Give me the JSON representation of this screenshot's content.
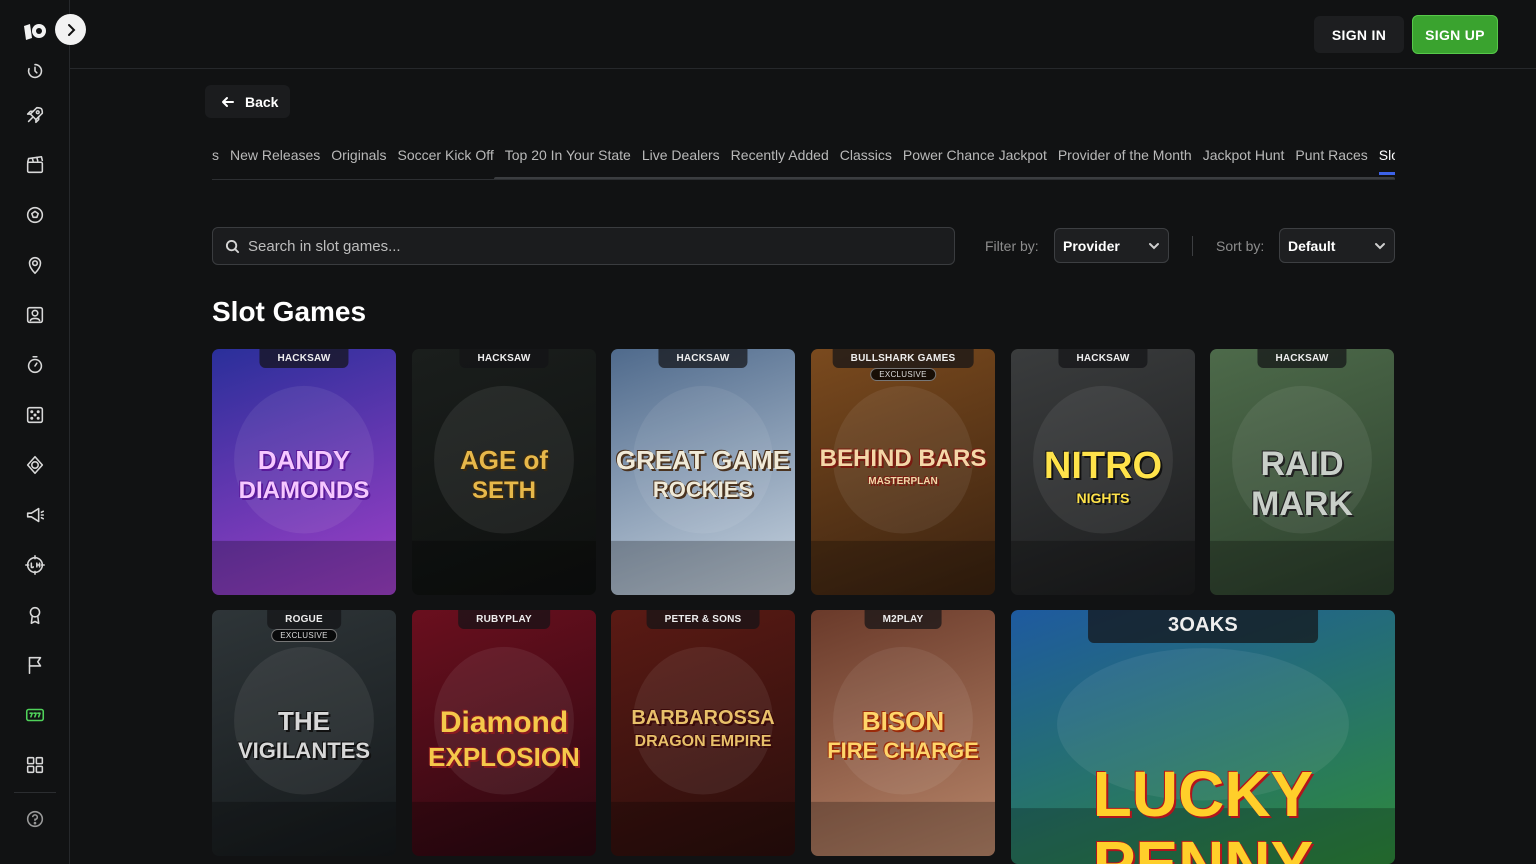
{
  "topbar": {
    "signin": "SIGN IN",
    "signup": "SIGN UP"
  },
  "back": {
    "label": "Back"
  },
  "tabs": [
    {
      "label": "s",
      "active": false
    },
    {
      "label": "New Releases",
      "active": false
    },
    {
      "label": "Originals",
      "active": false
    },
    {
      "label": "Soccer Kick Off",
      "active": false
    },
    {
      "label": "Top 20 In Your State",
      "active": false
    },
    {
      "label": "Live Dealers",
      "active": false
    },
    {
      "label": "Recently Added",
      "active": false
    },
    {
      "label": "Classics",
      "active": false
    },
    {
      "label": "Power Chance Jackpot",
      "active": false
    },
    {
      "label": "Provider of the Month",
      "active": false
    },
    {
      "label": "Jackpot Hunt",
      "active": false
    },
    {
      "label": "Punt Races",
      "active": false
    },
    {
      "label": "Slot Ga",
      "active": true
    }
  ],
  "search": {
    "placeholder": "Search in slot games..."
  },
  "filter": {
    "label": "Filter by:",
    "value": "Provider"
  },
  "sort": {
    "label": "Sort by:",
    "value": "Default"
  },
  "section": {
    "title": "Slot Games"
  },
  "games": [
    {
      "provider": "HACKSAW",
      "exclusive": "",
      "title_line1": "DANDY",
      "title_line2": "DIAMONDS",
      "bg1": "#2a2f9a",
      "bg2": "#a040c8"
    },
    {
      "provider": "HACKSAW",
      "exclusive": "",
      "title_line1": "AGE of",
      "title_line2": "SETH",
      "bg1": "#1a1e1c",
      "bg2": "#0e100f"
    },
    {
      "provider": "HACKSAW",
      "exclusive": "",
      "title_line1": "GREAT GAME",
      "title_line2": "ROCKIES",
      "bg1": "#4f6a8c",
      "bg2": "#c8d4e0"
    },
    {
      "provider": "BULLSHARK GAMES",
      "exclusive": "EXCLUSIVE",
      "title_line1": "BEHIND BARS",
      "title_line2": "MASTERPLAN",
      "bg1": "#7a4a1e",
      "bg2": "#3a2210"
    },
    {
      "provider": "HACKSAW",
      "exclusive": "",
      "title_line1": "NITRO",
      "title_line2": "NIGHTS",
      "bg1": "#3a3c3d",
      "bg2": "#1c1d1e"
    },
    {
      "provider": "HACKSAW",
      "exclusive": "",
      "title_line1": "RAID",
      "title_line2": "MARK",
      "bg1": "#4d6a4a",
      "bg2": "#2c3f2c"
    },
    {
      "provider": "ROGUE",
      "exclusive": "EXCLUSIVE",
      "title_line1": "THE",
      "title_line2": "VIGILANTES",
      "bg1": "#2e3538",
      "bg2": "#15191b"
    },
    {
      "provider": "RUBYPLAY",
      "exclusive": "",
      "title_line1": "Diamond",
      "title_line2": "EXPLOSION",
      "bg1": "#6a0f1e",
      "bg2": "#2a0810"
    },
    {
      "provider": "PETER & SONS",
      "exclusive": "",
      "title_line1": "BARBAROSSA",
      "title_line2": "DRAGON EMPIRE",
      "bg1": "#5a1a14",
      "bg2": "#2a0e0c"
    },
    {
      "provider": "M2PLAY",
      "exclusive": "",
      "title_line1": "BISON",
      "title_line2": "FIRE CHARGE",
      "bg1": "#6a3a2a",
      "bg2": "#b8866a"
    },
    {
      "provider": "3OAKS",
      "exclusive": "",
      "title_line1": "LUCKY",
      "title_line2": "PENNY",
      "bg1": "#1e5aa0",
      "bg2": "#2e8a3a"
    }
  ]
}
